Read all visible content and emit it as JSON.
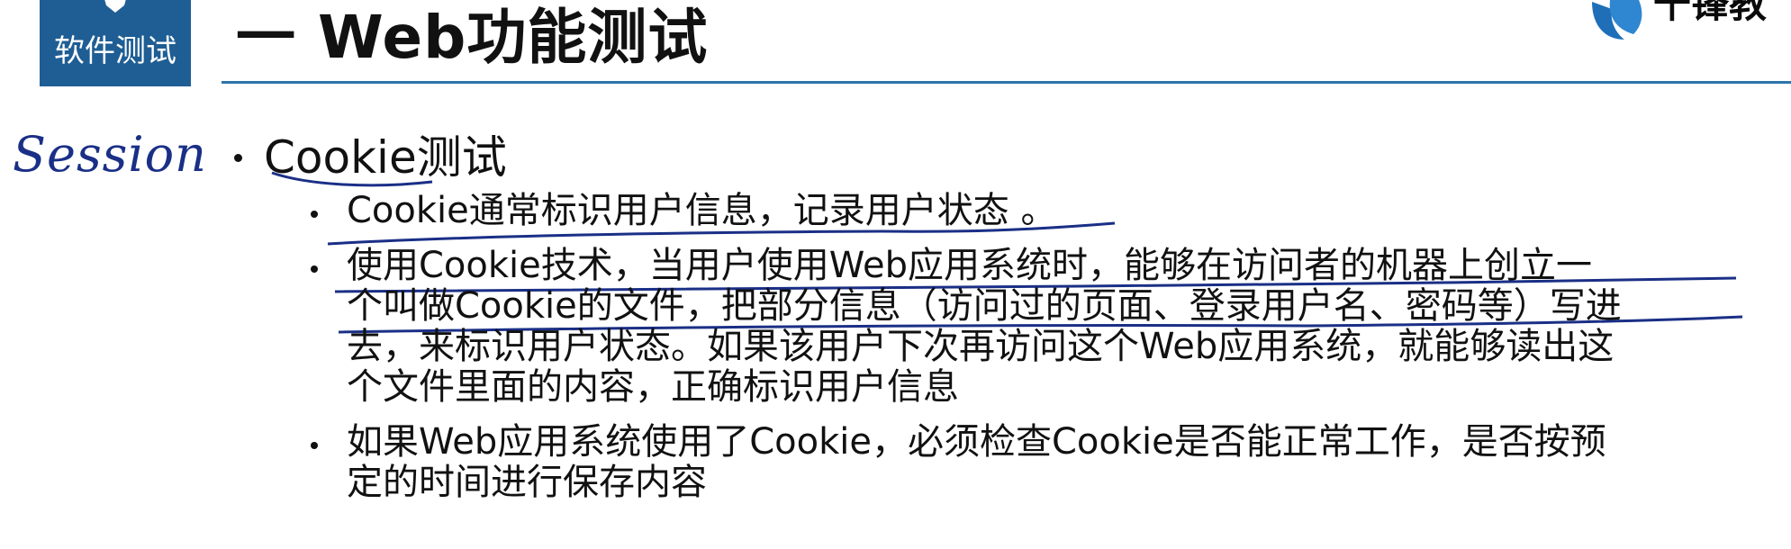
{
  "header": {
    "section_badge": "软件测试",
    "title": "一  Web功能测试",
    "brand_name": "千锋教"
  },
  "annotation": {
    "handwritten_note": "Session"
  },
  "content": {
    "heading": "Cookie测试",
    "items": [
      {
        "lines": [
          "Cookie通常标识用户信息，记录用户状态 。"
        ]
      },
      {
        "lines": [
          "使用Cookie技术，当用户使用Web应用系统时，能够在访问者的机器上创立一",
          "个叫做Cookie的文件，把部分信息（访问过的页面、登录用户名、密码等）写进",
          "去，来标识用户状态。如果该用户下次再访问这个Web应用系统，就能够读出这",
          "个文件里面的内容，正确标识用户信息"
        ]
      },
      {
        "lines": [
          "如果Web应用系统使用了Cookie，必须检查Cookie是否能正常工作，是否按预",
          "定的时间进行保存内容"
        ]
      }
    ]
  },
  "colors": {
    "badge_background": "#1f5e94",
    "title_rule": "#2e74aa",
    "ink_annotation": "#1a2f86",
    "text": "#111111"
  }
}
